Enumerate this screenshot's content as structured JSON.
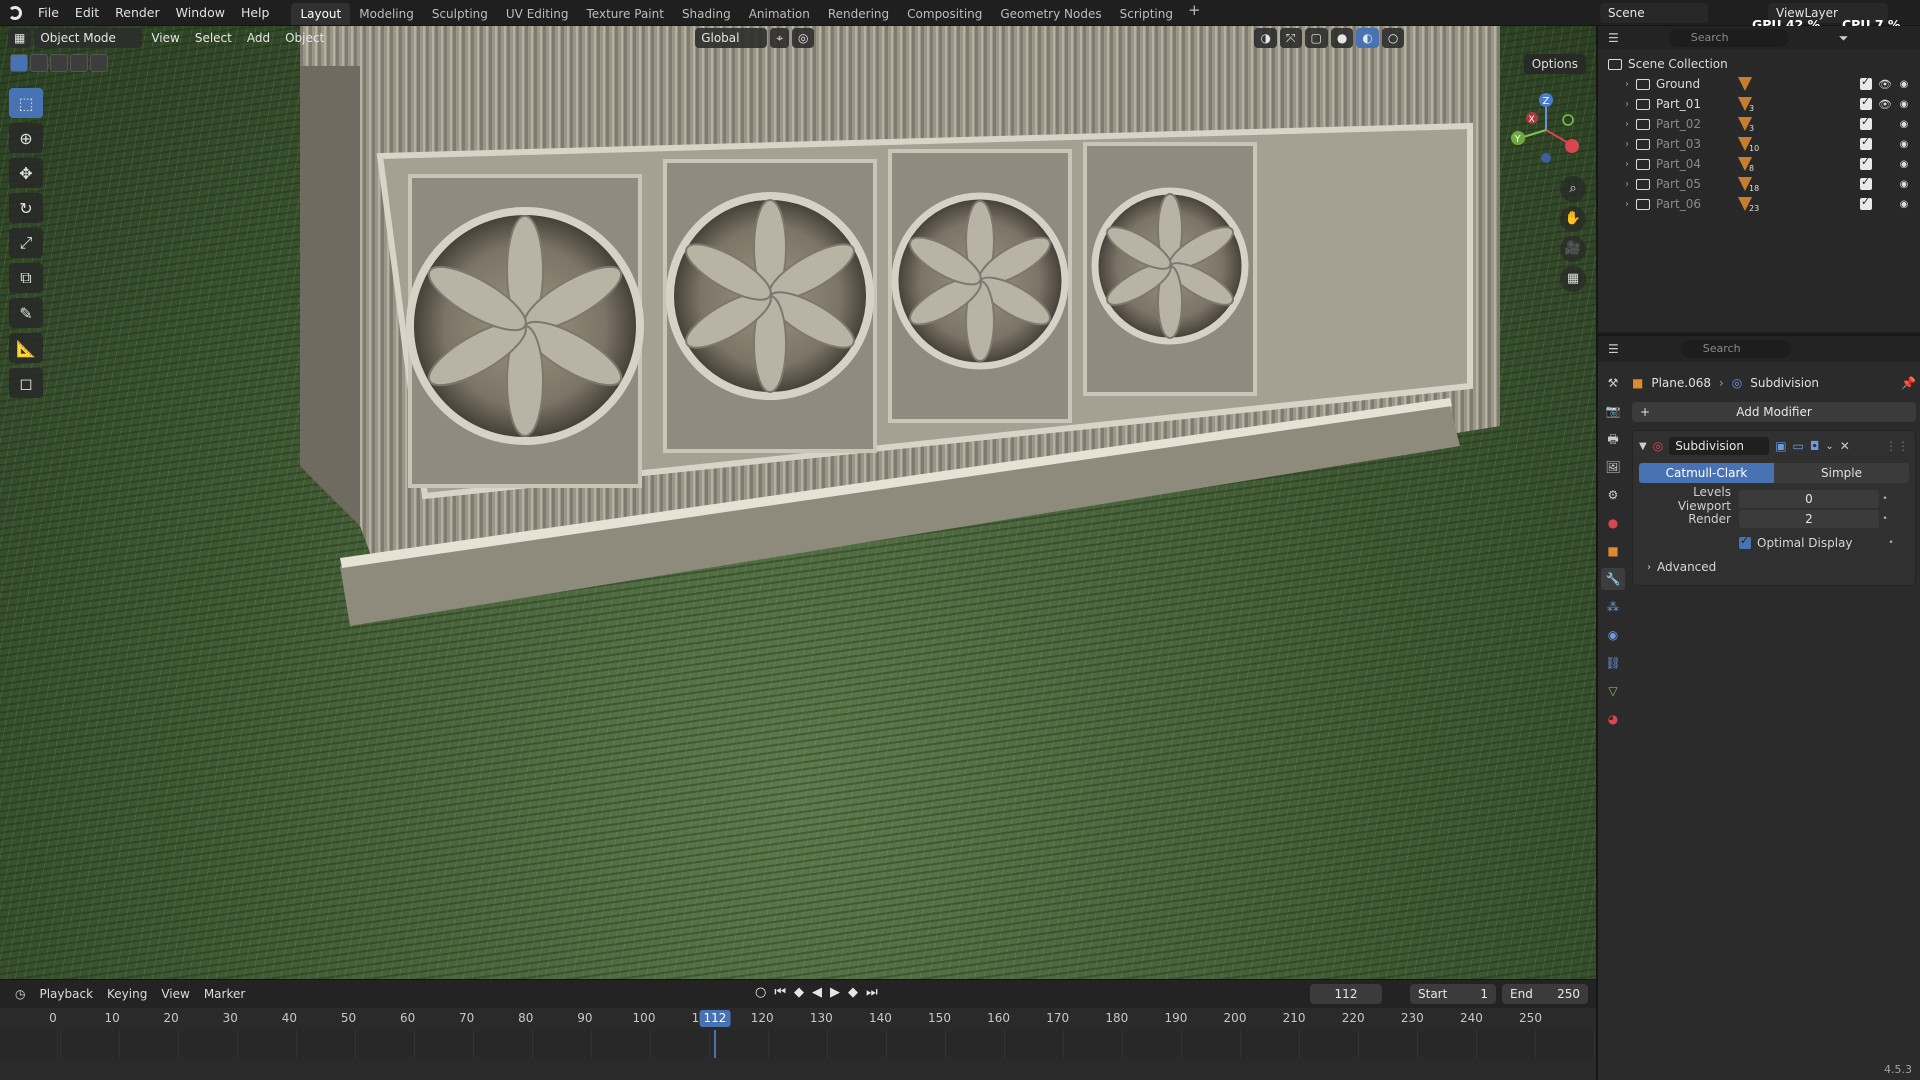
{
  "topbar": {
    "menus": [
      "File",
      "Edit",
      "Render",
      "Window",
      "Help"
    ],
    "workspaces": [
      "Layout",
      "Modeling",
      "Sculpting",
      "UV Editing",
      "Texture Paint",
      "Shading",
      "Animation",
      "Rendering",
      "Compositing",
      "Geometry Nodes",
      "Scripting"
    ],
    "active_workspace": "Layout",
    "add_workspace": "+",
    "scene": "Scene",
    "view_layer": "ViewLayer",
    "gpu": "GPU 42 %",
    "cpu": "CPU 7 %"
  },
  "viewport": {
    "mode": "Object Mode",
    "menus": [
      "View",
      "Select",
      "Add",
      "Object"
    ],
    "transform_orientation": "Global",
    "options": "Options",
    "tool_icons": [
      "select-box",
      "cursor",
      "move",
      "rotate",
      "scale",
      "transform",
      "annotate",
      "measure",
      "add-cube"
    ]
  },
  "timeline": {
    "menus": [
      "Playback",
      "Keying",
      "View",
      "Marker"
    ],
    "current_frame": "112",
    "start_label": "Start",
    "start_value": "1",
    "end_label": "End",
    "end_value": "250",
    "ticks": [
      "0",
      "10",
      "20",
      "30",
      "40",
      "50",
      "60",
      "70",
      "80",
      "90",
      "100",
      "110",
      "120",
      "130",
      "140",
      "150",
      "160",
      "170",
      "180",
      "190",
      "200",
      "210",
      "220",
      "230",
      "240",
      "250"
    ],
    "playhead_label": "112"
  },
  "outliner": {
    "search_placeholder": "Search",
    "root": "Scene Collection",
    "items": [
      {
        "name": "Ground",
        "count": "",
        "dim": false
      },
      {
        "name": "Part_01",
        "count": "3",
        "dim": false
      },
      {
        "name": "Part_02",
        "count": "3",
        "dim": true
      },
      {
        "name": "Part_03",
        "count": "10",
        "dim": true
      },
      {
        "name": "Part_04",
        "count": "8",
        "dim": true
      },
      {
        "name": "Part_05",
        "count": "18",
        "dim": true
      },
      {
        "name": "Part_06",
        "count": "23",
        "dim": true
      }
    ]
  },
  "properties": {
    "search_placeholder": "Search",
    "object": "Plane.068",
    "modifier_crumb": "Subdivision",
    "add_modifier": "Add Modifier",
    "modifier_name": "Subdivision",
    "algorithm_options": [
      "Catmull-Clark",
      "Simple"
    ],
    "algorithm_selected": "Catmull-Clark",
    "levels_viewport_label": "Levels Viewport",
    "levels_viewport_value": "0",
    "render_label": "Render",
    "render_value": "2",
    "optimal_display_label": "Optimal Display",
    "optimal_display_checked": true,
    "advanced_label": "Advanced"
  },
  "version": "4.5.3",
  "colors": {
    "accent": "#4772b3",
    "background": "#1d1d1d",
    "panel": "#2b2b2b"
  }
}
